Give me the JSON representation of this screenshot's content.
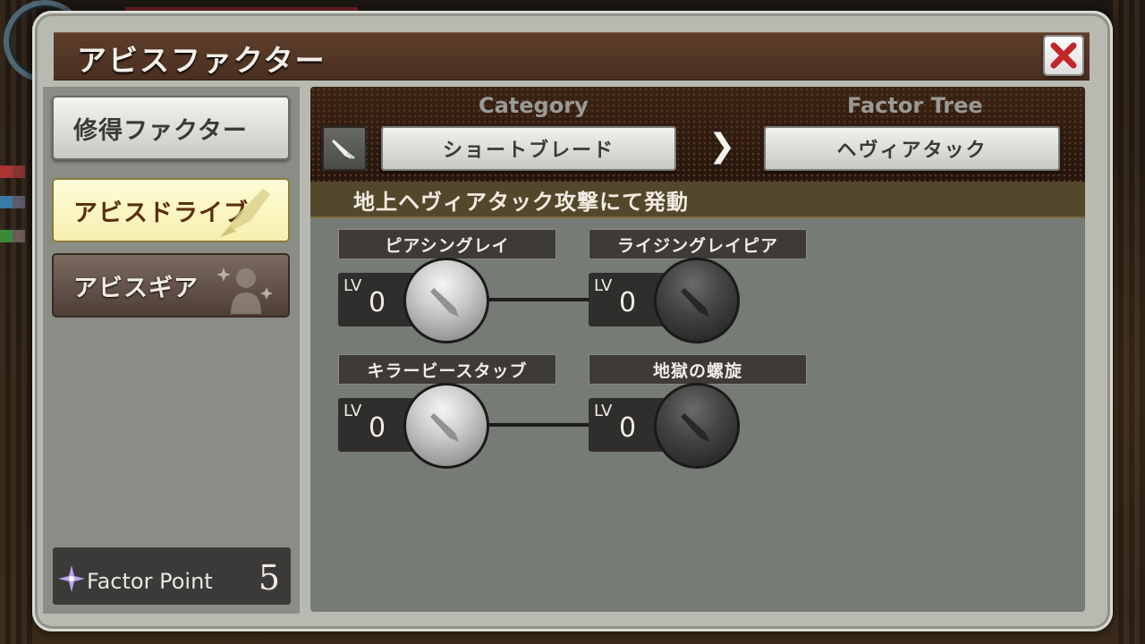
{
  "window": {
    "title": "アビスファクター"
  },
  "sidebar": {
    "items": [
      {
        "label": "修得ファクター",
        "state": "normal"
      },
      {
        "label": "アビスドライブ",
        "state": "active"
      },
      {
        "label": "アビスギア",
        "state": "normal-dark"
      }
    ]
  },
  "factor_point": {
    "label": "Factor Point",
    "value": "5"
  },
  "header": {
    "category_label": "Category",
    "factor_tree_label": "Factor Tree",
    "category_value": "ショートブレード",
    "factor_tree_value": "ヘヴィアタック",
    "arrow": "❯",
    "description": "地上ヘヴィアタック攻撃にて発動"
  },
  "skills": [
    {
      "name": "ピアシングレイ",
      "lv_label": "LV",
      "level": "0",
      "orb": "light"
    },
    {
      "name": "ライジングレイピア",
      "lv_label": "LV",
      "level": "0",
      "orb": "dark"
    },
    {
      "name": "キラービースタッブ",
      "lv_label": "LV",
      "level": "0",
      "orb": "light"
    },
    {
      "name": "地獄の螺旋",
      "lv_label": "LV",
      "level": "0",
      "orb": "dark"
    }
  ],
  "icons": {
    "close": "close-x-icon",
    "category": "short-blade-icon",
    "factor_point": "sparkle-icon",
    "orb": "blade-silhouette-icon"
  },
  "colors": {
    "title_bar": "#4a2f20",
    "active_item": "#f6efae",
    "close_x": "#c0262a"
  }
}
